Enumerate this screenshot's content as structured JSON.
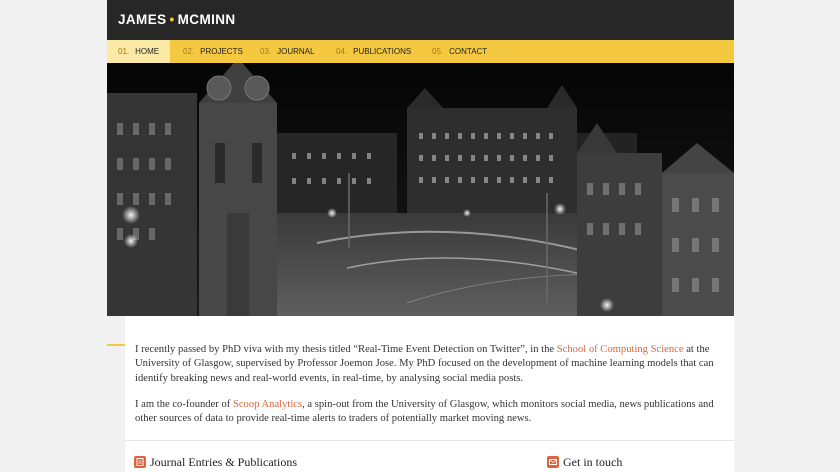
{
  "brand": {
    "first": "JAMES",
    "separator": "•",
    "last": "MCMINN"
  },
  "nav": [
    {
      "num": "01.",
      "label": "HOME",
      "active": true
    },
    {
      "num": "02.",
      "label": "PROJECTS"
    },
    {
      "num": "03.",
      "label": "JOURNAL"
    },
    {
      "num": "04.",
      "label": "PUBLICATIONS"
    },
    {
      "num": "05.",
      "label": "CONTACT"
    }
  ],
  "hero": {
    "image": "night-city-square-photo"
  },
  "intro": {
    "p1_a": "I recently passed by PhD viva with my thesis titled “Real-Time Event Detection on Twitter”, in the ",
    "p1_link": "School of Computing Science",
    "p1_b": " at the University of Glasgow, supervised by Professor Joemon Jose. My PhD focused on the development of machine learning models that can identify breaking news and real-world events, in real-time, by analysing social media posts.",
    "p2_a": "I am the co-founder of ",
    "p2_link": "Scoop Analytics",
    "p2_b": ", a spin-out from the University of Glasgow, which monitors social media, news publications and other sources of data to provide real-time alerts to traders of potentially market moving news."
  },
  "sections": {
    "journal": {
      "title": "Journal Entries & Publications",
      "icon": "document-icon"
    },
    "contact": {
      "title": "Get in touch",
      "icon": "envelope-icon"
    }
  },
  "colors": {
    "accent": "#f5c842",
    "link": "#d9663c",
    "header_bg": "#272727"
  }
}
